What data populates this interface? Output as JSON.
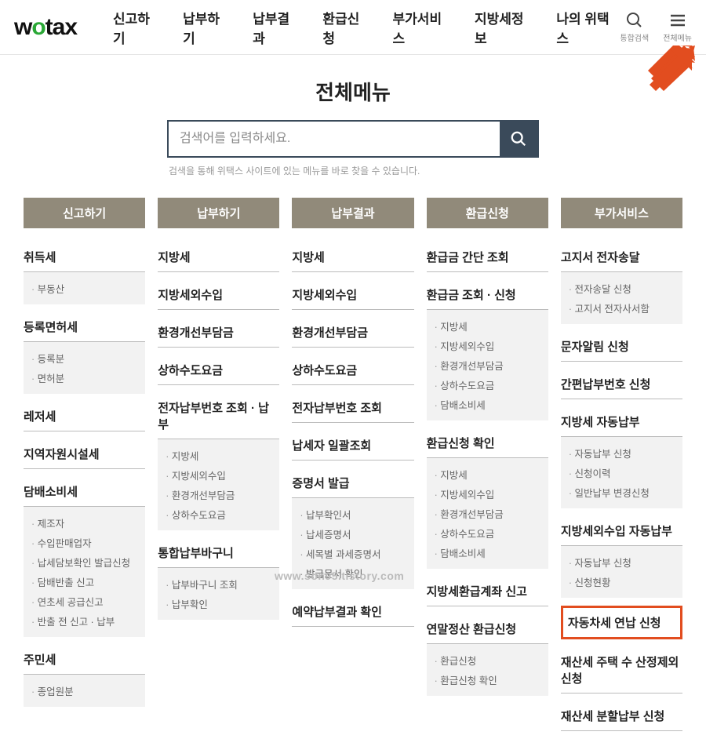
{
  "header": {
    "logo": {
      "pre": "w",
      "o": "o",
      "rest": "tax"
    },
    "nav": [
      "신고하기",
      "납부하기",
      "납부결과",
      "환급신청",
      "부가서비스",
      "지방세정보",
      "나의 위택스"
    ],
    "search_label": "통합검색",
    "menu_label": "전체메뉴"
  },
  "page": {
    "title": "전체메뉴"
  },
  "search": {
    "placeholder": "검색어를 입력하세요.",
    "hint": "검색을 통해 위택스 사이트에 있는 메뉴를 바로 찾을 수 있습니다."
  },
  "columns": [
    {
      "head": "신고하기",
      "sections": [
        {
          "title": "취득세",
          "items": [
            "부동산"
          ]
        },
        {
          "title": "등록면허세",
          "items": [
            "등록분",
            "면허분"
          ]
        },
        {
          "title": "레저세",
          "items": null
        },
        {
          "title": "지역자원시설세",
          "items": null
        },
        {
          "title": "담배소비세",
          "items": [
            "제조자",
            "수입판매업자",
            "납세담보확인 발급신청",
            "담배반출 신고",
            "연초세 공급신고",
            "반출 전 신고 · 납부"
          ]
        },
        {
          "title": "주민세",
          "items": [
            "종업원분"
          ]
        }
      ]
    },
    {
      "head": "납부하기",
      "sections": [
        {
          "title": "지방세",
          "items": null
        },
        {
          "title": "지방세외수입",
          "items": null
        },
        {
          "title": "환경개선부담금",
          "items": null
        },
        {
          "title": "상하수도요금",
          "items": null
        },
        {
          "title": "전자납부번호 조회 · 납부",
          "items": [
            "지방세",
            "지방세외수입",
            "환경개선부담금",
            "상하수도요금"
          ]
        },
        {
          "title": "통합납부바구니",
          "items": [
            "납부바구니 조회",
            "납부확인"
          ]
        }
      ]
    },
    {
      "head": "납부결과",
      "sections": [
        {
          "title": "지방세",
          "items": null
        },
        {
          "title": "지방세외수입",
          "items": null
        },
        {
          "title": "환경개선부담금",
          "items": null
        },
        {
          "title": "상하수도요금",
          "items": null
        },
        {
          "title": "전자납부번호 조회",
          "items": null
        },
        {
          "title": "납세자 일괄조회",
          "items": null
        },
        {
          "title": "증명서 발급",
          "items": [
            "납부확인서",
            "납세증명서",
            "세목별 과세증명서",
            "발급문서 확인"
          ]
        },
        {
          "title": "예약납부결과 확인",
          "items": null
        }
      ]
    },
    {
      "head": "환급신청",
      "sections": [
        {
          "title": "환급금 간단 조회",
          "items": null
        },
        {
          "title": "환급금 조회 · 신청",
          "items": [
            "지방세",
            "지방세외수입",
            "환경개선부담금",
            "상하수도요금",
            "담배소비세"
          ]
        },
        {
          "title": "환급신청 확인",
          "items": [
            "지방세",
            "지방세외수입",
            "환경개선부담금",
            "상하수도요금",
            "담배소비세"
          ]
        },
        {
          "title": "지방세환급계좌 신고",
          "items": null
        },
        {
          "title": "연말정산 환급신청",
          "items": [
            "환급신청",
            "환급신청 확인"
          ]
        }
      ]
    },
    {
      "head": "부가서비스",
      "sections": [
        {
          "title": "고지서 전자송달",
          "items": [
            "전자송달 신청",
            "고지서 전자사서함"
          ]
        },
        {
          "title": "문자알림 신청",
          "items": null
        },
        {
          "title": "간편납부번호 신청",
          "items": null
        },
        {
          "title": "지방세 자동납부",
          "items": [
            "자동납부 신청",
            "신청이력",
            "일반납부 변경신청"
          ]
        },
        {
          "title": "지방세외수입 자동납부",
          "items": [
            "자동납부 신청",
            "신청현황"
          ]
        },
        {
          "title": "자동차세 연납 신청",
          "items": null,
          "highlight": true
        },
        {
          "title": "재산세 주택 수 산정제외 신청",
          "items": null
        },
        {
          "title": "재산세 분할납부 신청",
          "items": null
        }
      ]
    }
  ],
  "watermark": "www.son95.tistory.com"
}
